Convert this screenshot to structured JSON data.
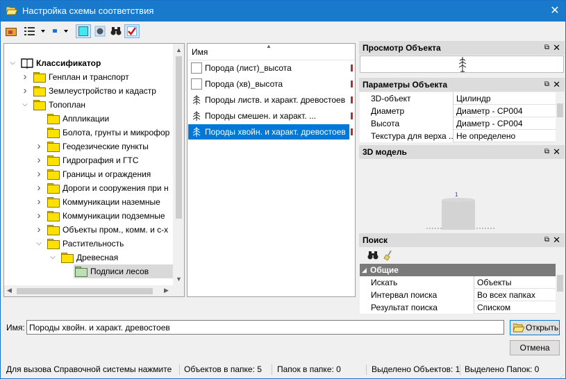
{
  "window": {
    "title": "Настройка схемы соответствия",
    "close_glyph": "✕"
  },
  "toolbar": {
    "icons": [
      "folder-up-icon",
      "view-list-icon",
      "small-icons-icon",
      "cyan-square-icon",
      "sphere-icon",
      "binoculars-icon",
      "checkmark-icon"
    ]
  },
  "tree": {
    "items": [
      {
        "label": "Классификатор",
        "level": 0,
        "expand": "open",
        "icon": "book"
      },
      {
        "label": "Генплан и транспорт",
        "level": 1,
        "expand": "closed",
        "icon": "folder"
      },
      {
        "label": "Землеустройство и кадастр",
        "level": 1,
        "expand": "closed",
        "icon": "folder"
      },
      {
        "label": "Топоплан",
        "level": 1,
        "expand": "open",
        "icon": "folder"
      },
      {
        "label": "Аппликации",
        "level": 2,
        "expand": "none",
        "icon": "folder"
      },
      {
        "label": "Болота, грунты и микрофор",
        "level": 2,
        "expand": "none",
        "icon": "folder"
      },
      {
        "label": "Геодезические пункты",
        "level": 2,
        "expand": "closed",
        "icon": "folder"
      },
      {
        "label": "Гидрография и ГТС",
        "level": 2,
        "expand": "closed",
        "icon": "folder"
      },
      {
        "label": "Границы и ограждения",
        "level": 2,
        "expand": "closed",
        "icon": "folder"
      },
      {
        "label": "Дороги и сооружения при н",
        "level": 2,
        "expand": "closed",
        "icon": "folder"
      },
      {
        "label": "Коммуникации наземные",
        "level": 2,
        "expand": "closed",
        "icon": "folder"
      },
      {
        "label": "Коммуникации подземные",
        "level": 2,
        "expand": "closed",
        "icon": "folder"
      },
      {
        "label": "Объекты пром., комм. и с-х",
        "level": 2,
        "expand": "closed",
        "icon": "folder"
      },
      {
        "label": "Растительность",
        "level": 2,
        "expand": "open",
        "icon": "folder"
      },
      {
        "label": "Древесная",
        "level": 3,
        "expand": "open",
        "icon": "folder"
      },
      {
        "label": "Подписи лесов",
        "level": 4,
        "expand": "none",
        "icon": "folder-green",
        "selected": true
      }
    ]
  },
  "list": {
    "header": "Имя",
    "items": [
      {
        "label": "Порода (лист)_высота",
        "selected": false
      },
      {
        "label": "Порода (хв)_высота",
        "selected": false
      },
      {
        "label": "Породы листв. и характ. древостоев",
        "selected": false
      },
      {
        "label": "Породы смешен. и характ. ...",
        "selected": false
      },
      {
        "label": "Породы хвойн. и характ. древостоев",
        "selected": true
      }
    ]
  },
  "preview": {
    "title": "Просмотр Объекта"
  },
  "params": {
    "title": "Параметры Объекта",
    "rows": [
      {
        "key": "3D-объект",
        "value": "Цилиндр"
      },
      {
        "key": "Диаметр",
        "value": "Диаметр - СР004"
      },
      {
        "key": "Высота",
        "value": "Диаметр - СР004"
      },
      {
        "key": "Текстура для верха ...",
        "value": "Не определено"
      }
    ]
  },
  "model3d": {
    "title": "3D модель",
    "label": "1"
  },
  "search": {
    "title": "Поиск",
    "group": "Общие",
    "rows": [
      {
        "key": "Искать",
        "value": "Объекты"
      },
      {
        "key": "Интервал поиска",
        "value": "Во всех папках"
      },
      {
        "key": "Результат поиска",
        "value": "Списком"
      }
    ]
  },
  "name_field": {
    "label": "Имя:",
    "value": "Породы хвойн. и характ. древостоев"
  },
  "buttons": {
    "open": "Открыть",
    "cancel": "Отмена"
  },
  "status": {
    "help": "Для вызова Справочной системы нажмите",
    "objects": "Объектов в папке: 5",
    "folders": "Папок в папке: 0",
    "sel_objects": "Выделено Объектов: 1",
    "sel_folders": "Выделено Папок: 0"
  },
  "colors": {
    "titlebar": "#1979ca",
    "selection": "#0078d7"
  }
}
